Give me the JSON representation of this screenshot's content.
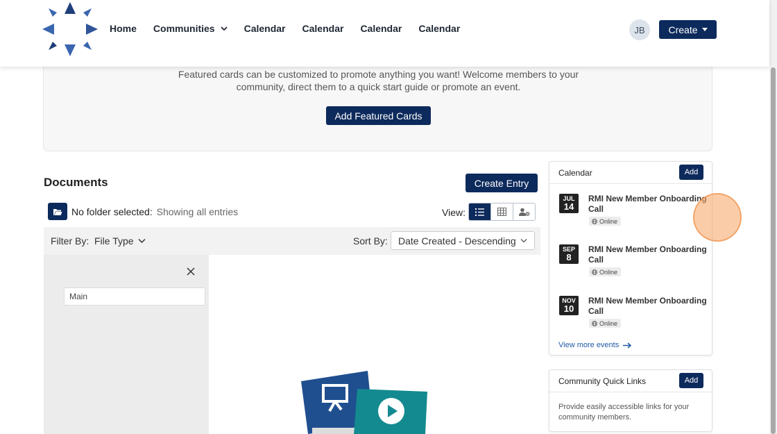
{
  "header": {
    "nav": [
      "Home",
      "Communities",
      "Calendar",
      "Calendar",
      "Calendar",
      "Calendar"
    ],
    "avatar_initials": "JB",
    "create_label": "Create"
  },
  "featured": {
    "text_line1": "Featured cards can be customized to promote anything you want! Welcome members to your",
    "text_line2": "community, direct them to a quick start guide or promote an event.",
    "button_label": "Add Featured Cards"
  },
  "documents": {
    "title": "Documents",
    "create_entry_label": "Create Entry",
    "folder_status": "No folder selected:",
    "folder_status_sub": "Showing all entries",
    "view_label": "View:",
    "filter_label": "Filter By:",
    "filter_value": "File Type",
    "sort_label": "Sort By:",
    "sort_value": "Date Created - Descending",
    "folder_item": "Main"
  },
  "calendar": {
    "title": "Calendar",
    "add_label": "Add",
    "events": [
      {
        "month": "JUL",
        "day": "14",
        "title": "RMI New Member Onboarding Call",
        "location": "Online"
      },
      {
        "month": "SEP",
        "day": "8",
        "title": "RMI New Member Onboarding Call",
        "location": "Online"
      },
      {
        "month": "NOV",
        "day": "10",
        "title": "RMI New Member Onboarding Call",
        "location": "Online"
      }
    ],
    "view_more": "View more events"
  },
  "quick_links": {
    "title": "Community Quick Links",
    "add_label": "Add",
    "description": "Provide easily accessible links for your community members."
  },
  "colors": {
    "primary": "#0d2a5c",
    "logo_blue": "#2f5597"
  }
}
